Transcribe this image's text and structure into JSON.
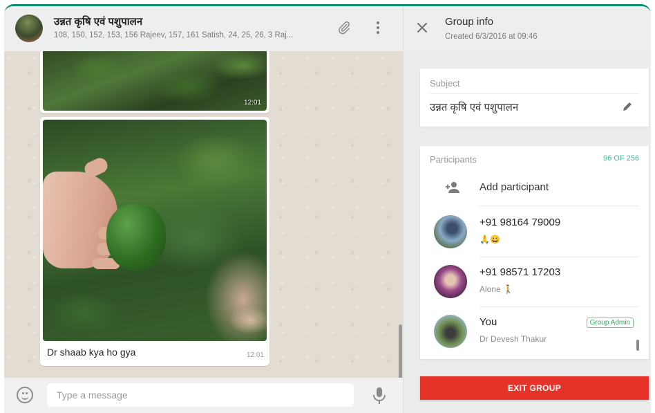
{
  "chat": {
    "title": "उन्नत कृषि एवं पशुपालन",
    "subtitle": "108, 150, 152, 153, 156 Rajeev, 157, 161 Satish, 24, 25, 26, 3 Raj...",
    "header_icons": [
      "paperclip-icon",
      "menu-icon"
    ],
    "messages": [
      {
        "type": "image",
        "time": "12:01"
      },
      {
        "type": "image",
        "caption": "Dr shaab kya ho gya",
        "time": "12:01"
      }
    ],
    "compose": {
      "placeholder": "Type a message"
    }
  },
  "group_info": {
    "title": "Group info",
    "created": "Created 6/3/2016 at 09:46",
    "subject_label": "Subject",
    "subject": "उन्नत कृषि एवं पशुपालन",
    "participants_label": "Participants",
    "participants_count": "96 OF 256",
    "add_participant": "Add participant",
    "participants": [
      {
        "name": "+91 98164 79009",
        "status": "🙏😀"
      },
      {
        "name": "+91 98571 17203",
        "status": "Alone 🚶"
      },
      {
        "name": "You",
        "status": "Dr Devesh Thakur",
        "badge": "Group Admin"
      }
    ],
    "exit_button": "EXIT GROUP"
  },
  "colors": {
    "accent_top_bar": "#0b8f72",
    "participants_count": "#37c09a",
    "exit_button": "#e5332a",
    "chat_background": "#e5ddd5"
  }
}
